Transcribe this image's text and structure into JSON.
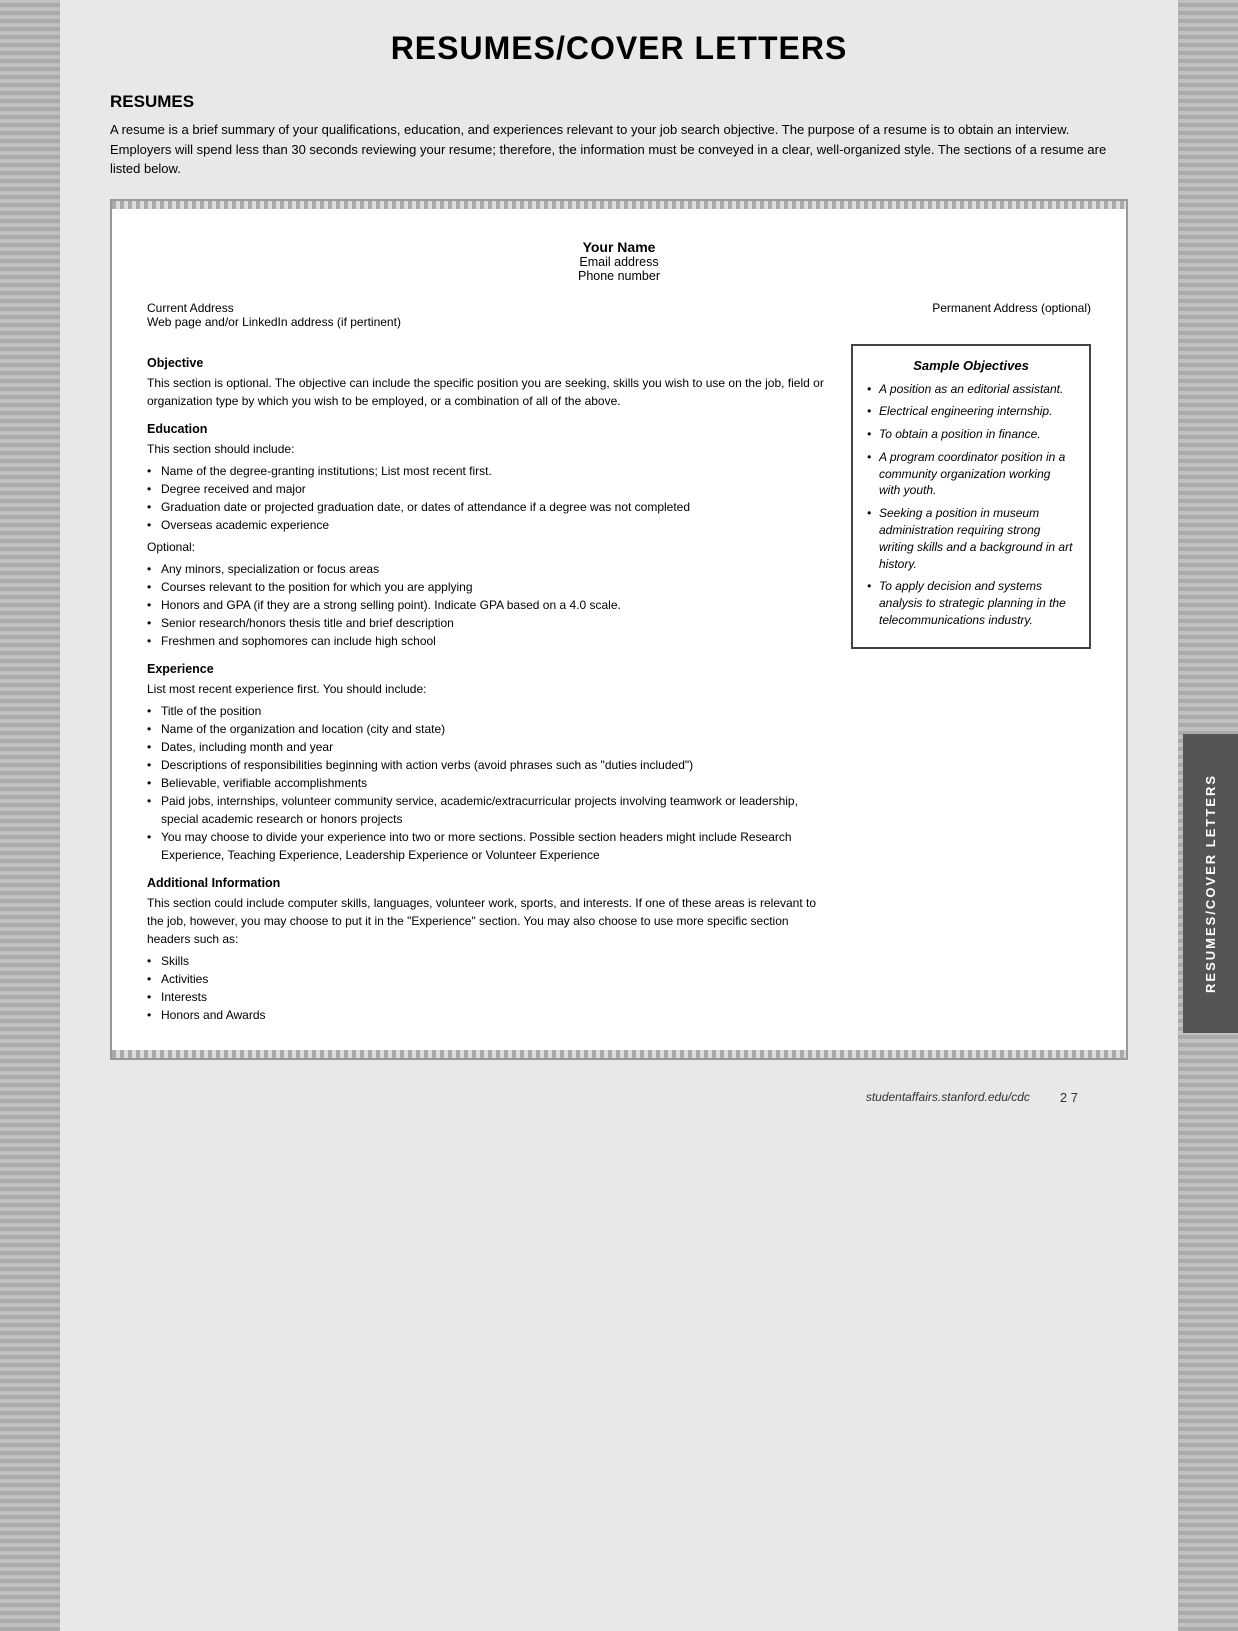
{
  "page": {
    "title": "RESUMES/COVER LETTERS",
    "vertical_tab": "RESUMES/COVER LETTERS"
  },
  "resumes_section": {
    "heading": "RESUMES",
    "intro": "A resume is a brief summary of your qualifications, education, and experiences relevant to your job search objective. The purpose of a resume is to obtain an interview. Employers will spend less than 30 seconds reviewing your resume; therefore, the information must be conveyed in a clear, well-organized style. The sections of a resume are listed below."
  },
  "resume_template": {
    "name": "Your Name",
    "email": "Email address",
    "phone": "Phone number",
    "current_address": "Current Address",
    "web_address": "Web page and/or LinkedIn address (if pertinent)",
    "permanent_address": "Permanent Address (optional)"
  },
  "objective_section": {
    "title": "Objective",
    "text": "This section is optional. The objective can include the specific position you are seeking, skills you wish to use on the job, field or organization type by which you wish to be employed, or a combination of all of the above."
  },
  "sample_objectives": {
    "title": "Sample Objectives",
    "items": [
      "A position as an editorial assistant.",
      "Electrical engineering internship.",
      "To obtain a position in finance.",
      "A program coordinator position in a community organization working with youth.",
      "Seeking a position in museum administration requiring strong writing skills and a background in art history.",
      "To apply decision and systems analysis to strategic planning in the telecommunications industry."
    ]
  },
  "education_section": {
    "title": "Education",
    "intro": "This section should include:",
    "required_items": [
      "Name of the degree-granting institutions; List most recent first.",
      "Degree received and major",
      "Graduation date or projected graduation date, or dates of attendance if a degree was not completed",
      "Overseas academic experience"
    ],
    "optional_label": "Optional:",
    "optional_items": [
      "Any minors, specialization or focus areas",
      "Courses relevant to the position for which you are applying",
      "Honors and GPA (if they are a strong selling point). Indicate GPA based on a 4.0 scale.",
      "Senior research/honors thesis title and brief description",
      "Freshmen and sophomores can include high school"
    ]
  },
  "experience_section": {
    "title": "Experience",
    "intro": "List most recent experience first. You should include:",
    "items": [
      "Title of the position",
      "Name of the organization and location (city and state)",
      "Dates, including month and year",
      "Descriptions of responsibilities beginning with action verbs (avoid phrases such as \"duties included\")",
      "Believable, verifiable accomplishments",
      "Paid jobs, internships, volunteer community service, academic/extracurricular projects involving teamwork or leadership, special academic research or honors projects",
      "You may choose to divide your experience into two or more sections. Possible section headers might include Research Experience, Teaching Experience, Leadership Experience or Volunteer Experience"
    ]
  },
  "additional_info_section": {
    "title": "Additional Information",
    "intro": "This section could include computer skills, languages, volunteer work, sports, and interests. If one of these areas is relevant to the job, however, you may choose to put it in the \"Experience\" section. You may also choose to use more specific section headers such as:",
    "items": [
      "Skills",
      "Activities",
      "Interests",
      "Honors and Awards"
    ]
  },
  "footer": {
    "url": "studentaffairs.stanford.edu/cdc",
    "page": "2 7"
  }
}
